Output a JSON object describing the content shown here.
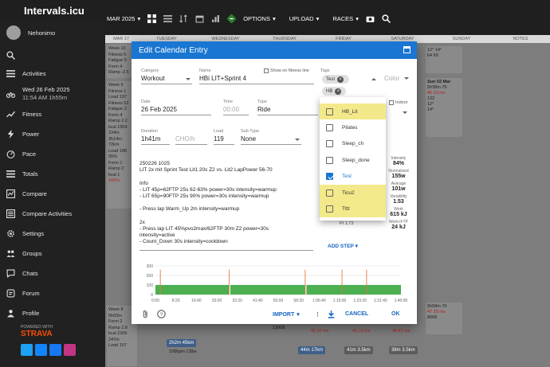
{
  "app": {
    "title": "Intervals.icu"
  },
  "toolbar": {
    "month": "MAR 2025",
    "options": "OPTIONS",
    "upload": "UPLOAD",
    "races": "RACES"
  },
  "sidebar": {
    "user": "Nehonimo",
    "items": [
      {
        "label": "Activities",
        "icon": "bike-icon"
      },
      {
        "label": "Fitness",
        "icon": "trending-icon"
      },
      {
        "label": "Power",
        "icon": "bolt-icon"
      },
      {
        "label": "Pace",
        "icon": "speedometer-icon"
      },
      {
        "label": "Totals",
        "icon": "list-icon"
      },
      {
        "label": "Compare",
        "icon": "compare-icon"
      },
      {
        "label": "Compare Activities",
        "icon": "compare-activities-icon"
      },
      {
        "label": "Settings",
        "icon": "gear-icon"
      },
      {
        "label": "Groups",
        "icon": "groups-icon"
      },
      {
        "label": "Chats",
        "icon": "chat-icon"
      },
      {
        "label": "Forum",
        "icon": "forum-icon"
      },
      {
        "label": "Profile",
        "icon": "profile-icon"
      }
    ],
    "date_line1": "Wed 26 Feb 2025",
    "date_line2": "11:54 AM   1h55m",
    "powered": "POWERED WITH",
    "strava": "STRAVA"
  },
  "calendar": {
    "days": [
      "MAR 17",
      "TUESDAY",
      "WEDNESDAY",
      "THURSDAY",
      "FRIDAY",
      "SATURDAY",
      "SUNDAY",
      "NOTES"
    ],
    "week1": [
      "Week 10",
      "Fitness 5",
      "Fatigue 5",
      "Form 4",
      "Ramp -2.5"
    ],
    "week2": [
      "Week 9",
      "Fitness 1",
      "Load 197",
      "Fitness 52",
      "Fatigue 2",
      "Form 4",
      "Ramp 2.2",
      "kcal 1954",
      "234m",
      "3h14m",
      "72km",
      "Load 188",
      "95%",
      "Form 1",
      "Ramp 2",
      "kcal 1",
      "165%"
    ],
    "week3": [
      "Week 8",
      "5h03m",
      "Form 2",
      "Ramp 2.8",
      "kcal 2306",
      "247m",
      "Load 157"
    ],
    "sun_card": [
      "Sun 02 Mar",
      "5h38m 75",
      "45 23 ms",
      "132",
      "12°",
      "14°"
    ],
    "sun_card2": [
      "5h58m 70",
      "47 29 ms",
      "8068"
    ],
    "chip1": "2h2m 45km",
    "chip2": "44m 17km",
    "chip3": "41m 3.5km",
    "chip4": "38m 3.5km",
    "misc1": "13008",
    "misc2": "1086pm 128w",
    "misc3": "42.37 mc",
    "misc4": "42.13 mc",
    "misc5": "45.41 ms",
    "misc6": "2h2m",
    "weather1": "12° 14°",
    "weather2": "64 69"
  },
  "dialog": {
    "title": "Edit Calendar Entry",
    "category_label": "Category",
    "category": "Workout",
    "name_label": "Name",
    "name": "HBi LIT+Sprint 4",
    "show_fitness": "Show on fitness line",
    "tags_label": "Tags",
    "tag_chips": [
      "Test",
      "HB"
    ],
    "color_label": "Color",
    "date_label": "Date",
    "date": "26 Feb 2025",
    "time_label": "Time",
    "time_placeholder": "00:00",
    "type_label": "Type",
    "type": "Ride",
    "indoor_label": "Indoor",
    "duration_label": "Duration",
    "duration": "1h41m",
    "cho_placeholder": "CHO/h",
    "load_label": "Load",
    "load": "119",
    "subtype_label": "Sub Type",
    "subtype": "None",
    "description": "250226 1025\nLIT 2x mit Sprint Test Lit1 20s Z2 vs. Lit2 LapPower 56-70\n\nInfo\n- LIT 45p=62FTP 25s 62-63% power=30s intensity=warmup\n- LIT 65p=90FTP 25s 90% power=30s intensity=warmup\n\n- Press lap Warm_Up 2m intensity=warmup\n\n2x\n- Press lap LIT 45%pvo2max/62FTP 30m Z2 power=30s\nintensity=active\n- Count_Down 30s intensity=cooldown",
    "pi_note": "PI 1.73",
    "add_step": "ADD STEP",
    "import": "IMPORT",
    "cancel": "CANCEL",
    "ok": "OK",
    "stats": [
      {
        "k": "Intensity",
        "v": "84%"
      },
      {
        "k": "Normalized",
        "v": "155w"
      },
      {
        "k": "Average",
        "v": "101w"
      },
      {
        "k": "Variability",
        "v": "1.53"
      },
      {
        "k": "Work",
        "v": "615 kJ"
      },
      {
        "k": "Work>FTP",
        "v": "24 kJ"
      }
    ]
  },
  "tags_dropdown": {
    "options": [
      {
        "label": "HB_Lit",
        "checked": false,
        "highlighted": true
      },
      {
        "label": "Pilates",
        "checked": false,
        "highlighted": false
      },
      {
        "label": "Sleep_ch",
        "checked": false,
        "highlighted": false
      },
      {
        "label": "Sleep_done",
        "checked": false,
        "highlighted": false
      },
      {
        "label": "Test",
        "checked": true,
        "highlighted": false
      },
      {
        "label": "Ticu2",
        "checked": false,
        "highlighted": true
      },
      {
        "label": "Tttt",
        "checked": false,
        "highlighted": true
      }
    ]
  },
  "chart_data": {
    "type": "bar",
    "ylim": [
      0,
      300
    ],
    "yticks": [
      "300",
      "200",
      "100",
      "0"
    ],
    "xticks": [
      "0:00",
      "8:20",
      "16:40",
      "25:00",
      "33:20",
      "41:40",
      "50:00",
      "58:20",
      "1:06:40",
      "1:15:00",
      "1:23:20",
      "1:31:40",
      "1:40:00"
    ],
    "x_max": 100,
    "bar_color": "#4caf50",
    "spike_color": "#e07a3a",
    "blocks": [
      {
        "start": 0,
        "end": 30,
        "value": 100
      },
      {
        "start": 30.5,
        "end": 61,
        "value": 100
      },
      {
        "start": 61.5,
        "end": 100,
        "value": 100
      }
    ],
    "spikes": [
      2,
      30,
      61,
      76,
      86
    ],
    "spike_value": 260
  },
  "colors": {
    "accent": "#1976d2",
    "highlight": "#f3e98a",
    "strava": "#fc4c02"
  }
}
